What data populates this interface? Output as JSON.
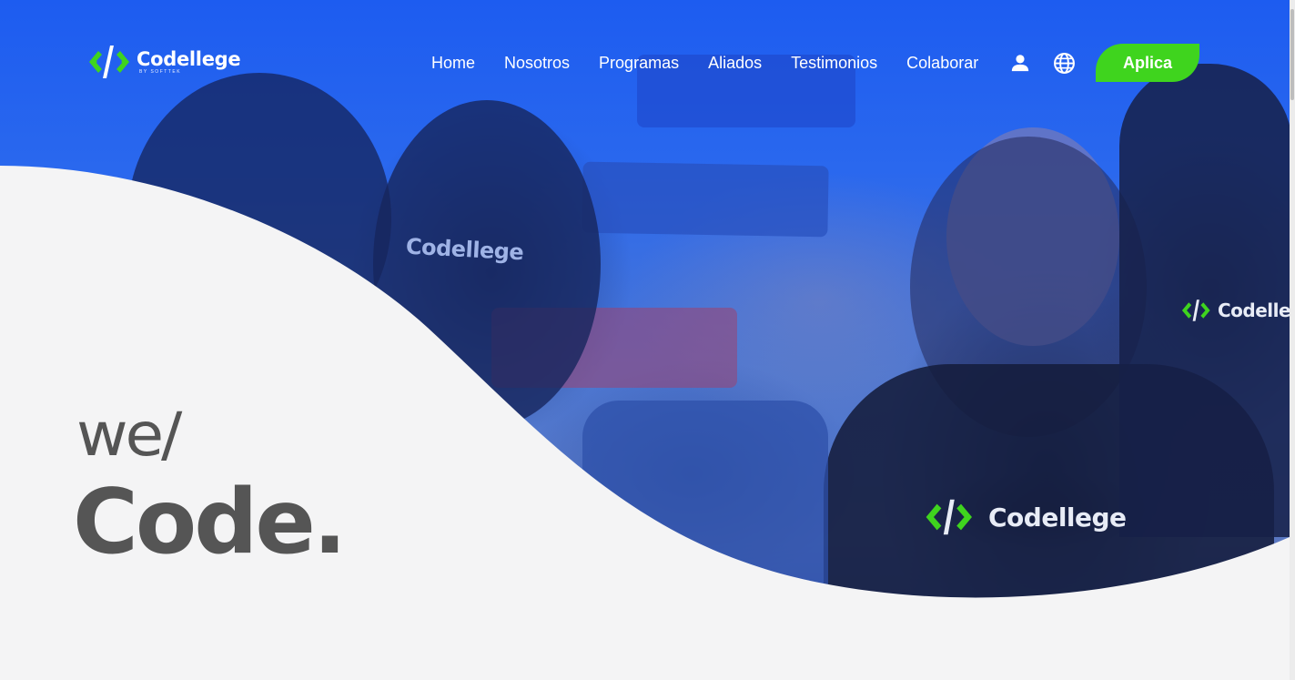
{
  "brand": {
    "name": "Codellege",
    "tagline": "BY SOFTTEK"
  },
  "nav": {
    "items": [
      {
        "label": "Home"
      },
      {
        "label": "Nosotros"
      },
      {
        "label": "Programas"
      },
      {
        "label": "Aliados"
      },
      {
        "label": "Testimonios"
      },
      {
        "label": "Colaborar"
      }
    ],
    "apply_label": "Aplica"
  },
  "hero": {
    "line1": "we/",
    "line2": "Code."
  },
  "photo": {
    "shirt_text": "Codellege"
  },
  "icons": {
    "user": "user-icon",
    "globe": "globe-icon",
    "logo": "code-brackets-logo"
  },
  "colors": {
    "accent_green": "#3fd41e",
    "hero_blue": "#1d5cf0",
    "background": "#f4f4f5",
    "hero_text": "#555555"
  }
}
